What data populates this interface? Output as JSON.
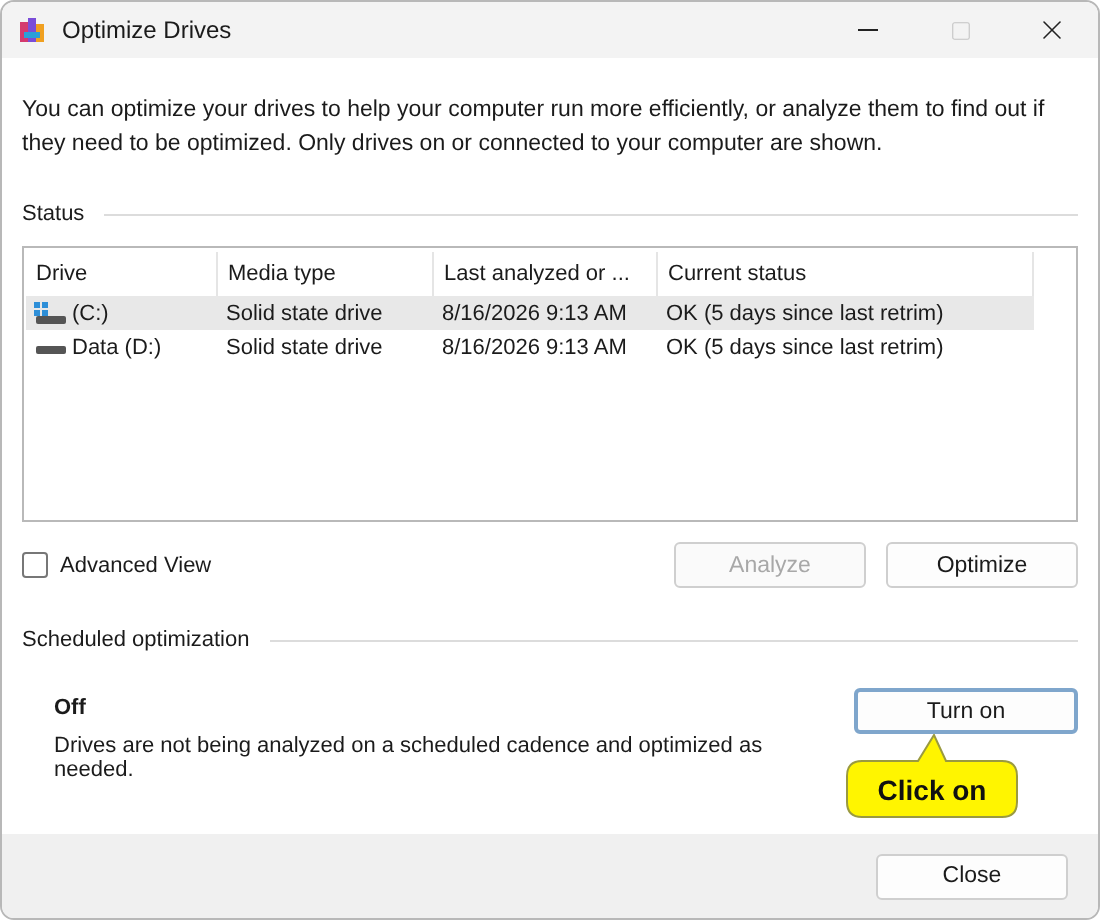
{
  "window": {
    "title": "Optimize Drives",
    "maximize_disabled": true
  },
  "description": "You can optimize your drives to help your computer run more efficiently, or analyze them to find out if they need to be optimized. Only drives on or connected to your computer are shown.",
  "status": {
    "heading": "Status",
    "columns": [
      "Drive",
      "Media type",
      "Last analyzed or ...",
      "Current status"
    ],
    "rows": [
      {
        "kind": "system",
        "drive": "(C:)",
        "media_type": "Solid state drive",
        "last_analyzed": "8/16/2026 9:13 AM",
        "current_status": "OK (5 days since last retrim)",
        "selected": true
      },
      {
        "kind": "data",
        "drive": "Data (D:)",
        "media_type": "Solid state drive",
        "last_analyzed": "8/16/2026 9:13 AM",
        "current_status": "OK (5 days since last retrim)",
        "selected": false
      }
    ],
    "advanced_view": {
      "label": "Advanced View",
      "checked": false
    },
    "buttons": [
      {
        "label": "Analyze",
        "disabled": true
      },
      {
        "label": "Optimize",
        "disabled": false
      }
    ]
  },
  "scheduled": {
    "heading": "Scheduled optimization",
    "state": "Off",
    "description": "Drives are not being analyzed on a scheduled cadence and optimized as needed.",
    "button": "Turn on",
    "callout": "Click on"
  },
  "footer": {
    "button": "Close"
  }
}
